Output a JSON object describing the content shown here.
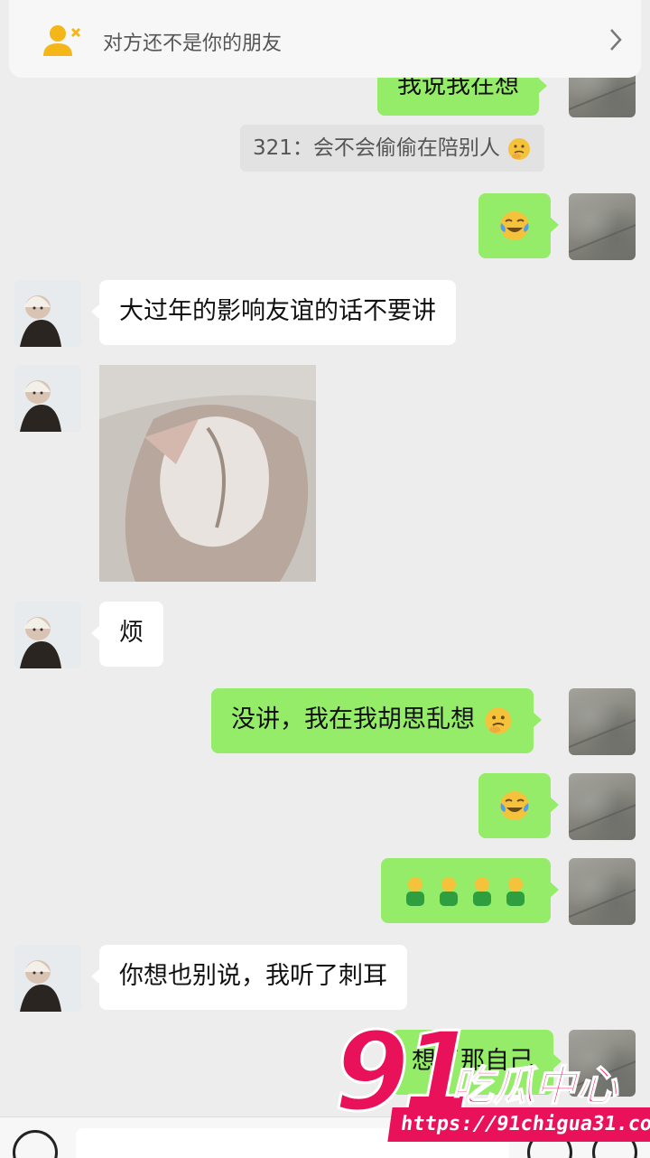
{
  "notice": {
    "text": "对方还不是你的朋友"
  },
  "messages": {
    "m0": {
      "text": "我说我在想"
    },
    "m1": {
      "quote": "321：会不会偷偷在陪别人"
    },
    "m3": {
      "text": "大过年的影响友谊的话不要讲"
    },
    "m5": {
      "text": "烦"
    },
    "m6": {
      "text": "没讲，我在我胡思乱想"
    },
    "m9": {
      "text": "你想也别说，我听了刺耳"
    },
    "m10": {
      "text": "想了那自己"
    }
  },
  "watermark": {
    "big": "91",
    "name": "吃瓜中心",
    "url": "https://91chigua31.com"
  },
  "colors": {
    "my_bubble": "#95ec69",
    "their_bubble": "#ffffff",
    "background": "#ededed",
    "watermark": "#e8115a"
  }
}
